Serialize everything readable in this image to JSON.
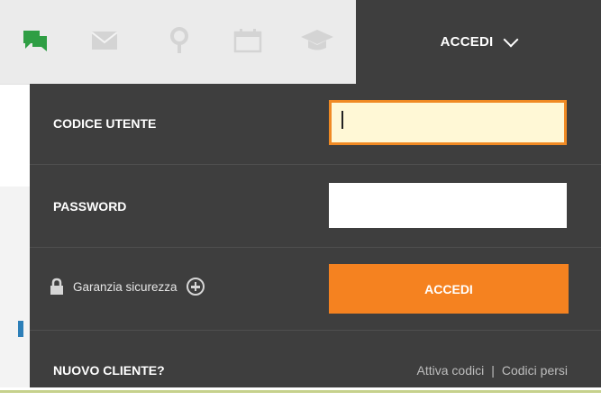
{
  "topbar": {
    "icons": [
      "chat-icon",
      "mail-icon",
      "location-pin-icon",
      "calendar-icon",
      "graduation-cap-icon"
    ],
    "accent_color": "#2f9e44"
  },
  "login": {
    "header_label": "ACCEDI",
    "user_code_label": "CODICE UTENTE",
    "user_code_value": "",
    "password_label": "PASSWORD",
    "password_value": "",
    "security_label": "Garanzia sicurezza",
    "submit_label": "ACCEDI",
    "new_client_label": "NUOVO CLIENTE?",
    "activate_codes_link": "Attiva codici",
    "divider": "|",
    "lost_codes_link": "Codici persi",
    "button_color": "#f58220",
    "panel_color": "#3e3e3e"
  }
}
